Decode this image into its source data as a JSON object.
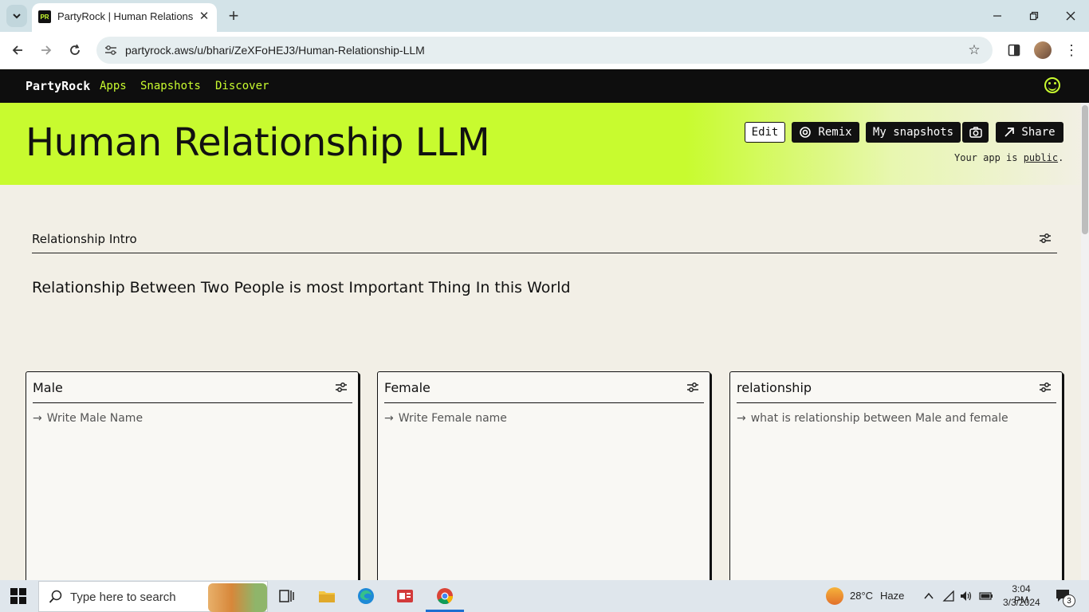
{
  "browser": {
    "tab_title": "PartyRock | Human Relationship",
    "tab_favicon_text": "PR",
    "url": "partyrock.aws/u/bhari/ZeXFoHEJ3/Human-Relationship-LLM"
  },
  "site": {
    "logo": "PartyRock",
    "nav": [
      "Apps",
      "Snapshots",
      "Discover"
    ],
    "accent": "#c8fb2f"
  },
  "hero": {
    "title": "Human Relationship LLM",
    "edit_label": "Edit",
    "remix_label": "Remix",
    "snapshots_label": "My snapshots",
    "share_label": "Share",
    "public_prefix": "Your app is ",
    "public_link": "public",
    "public_suffix": "."
  },
  "intro": {
    "title": "Relationship Intro",
    "text": "Relationship Between Two People is most Important Thing In this World"
  },
  "cards": [
    {
      "title": "Male",
      "placeholder": "Write Male Name"
    },
    {
      "title": "Female",
      "placeholder": "Write Female name"
    },
    {
      "title": "relationship",
      "placeholder": "what is relationship between Male and female"
    }
  ],
  "taskbar": {
    "search_placeholder": "Type here to search",
    "weather_temp": "28°C",
    "weather_cond": "Haze",
    "time": "3:04 PM",
    "date": "3/3/2024",
    "notification_count": "3"
  }
}
